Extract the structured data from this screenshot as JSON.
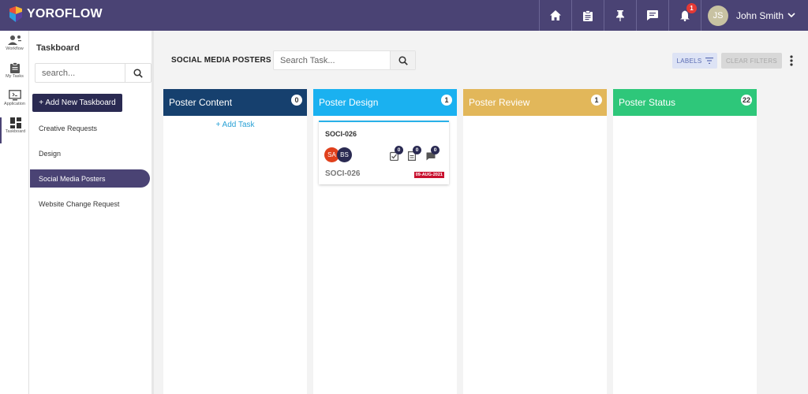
{
  "app": {
    "logo_text": "YOROFLOW",
    "notification_count": "1",
    "user": {
      "initials": "JS",
      "name": "John Smith"
    },
    "top_icons": [
      "home-icon",
      "clipboard-icon",
      "pin-icon",
      "chat-icon",
      "bell-icon"
    ]
  },
  "rail": {
    "items": [
      {
        "label": "Workflow",
        "icon": "workflow-icon"
      },
      {
        "label": "My Tasks",
        "icon": "my-tasks-icon"
      },
      {
        "label": "Application",
        "icon": "application-icon"
      },
      {
        "label": "Taskboard",
        "icon": "taskboard-icon"
      }
    ]
  },
  "sidebar": {
    "title": "Taskboard",
    "search_placeholder": "search...",
    "add_button": "+ Add New Taskboard",
    "items": [
      {
        "label": "Creative Requests"
      },
      {
        "label": "Design"
      },
      {
        "label": "Social Media Posters",
        "active": true
      },
      {
        "label": "Website Change Request"
      }
    ]
  },
  "board": {
    "title": "SOCIAL MEDIA POSTERS",
    "search_placeholder": "Search Task...",
    "labels_button": "LABELS",
    "clear_filters_button": "CLEAR FILTERS",
    "columns": [
      {
        "name": "Poster Content",
        "count": "0",
        "color": "#16406e",
        "add_task": "+ Add Task"
      },
      {
        "name": "Poster Design",
        "count": "1",
        "color": "#1ab1f0"
      },
      {
        "name": "Poster Review",
        "count": "1",
        "color": "#e2b75a"
      },
      {
        "name": "Poster Status",
        "count": "22",
        "color": "#2ec77a"
      }
    ],
    "card": {
      "id": "SOCI-026",
      "subtitle": "SOCI-026",
      "assignees": [
        {
          "initials": "SA",
          "color": "#e0401c"
        },
        {
          "initials": "BS",
          "color": "#2a2a52"
        }
      ],
      "checklist_count": "0",
      "attachment_count": "0",
      "comment_count": "0",
      "due_date": "09-AUG-2021"
    }
  }
}
